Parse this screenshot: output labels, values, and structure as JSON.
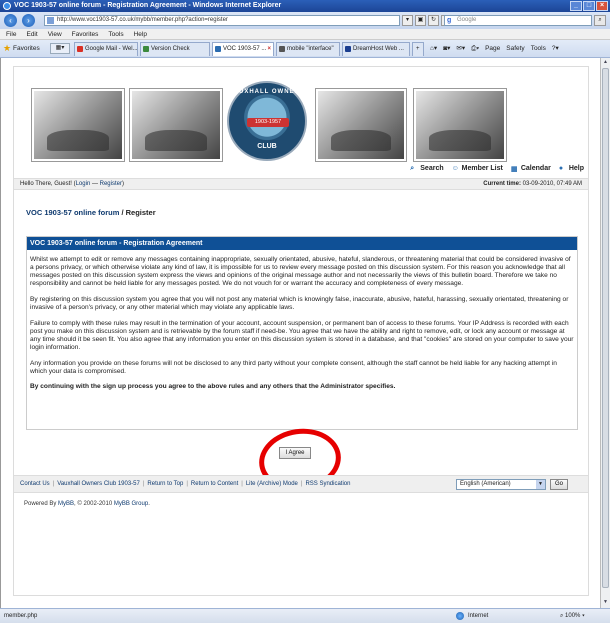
{
  "window": {
    "title": "VOC 1903-57 online forum - Registration Agreement - Windows Internet Explorer"
  },
  "address_bar": {
    "url": "http://www.voc1903-57.co.uk/mybb/member.php?action=register",
    "search_placeholder": "Google"
  },
  "menu": [
    "File",
    "Edit",
    "View",
    "Favorites",
    "Tools",
    "Help"
  ],
  "favorites_label": "Favorites",
  "tabs": [
    {
      "label": "Google Mail - Wel...",
      "color": "#d93025",
      "active": false
    },
    {
      "label": "Version Check",
      "color": "#3c8a3c",
      "active": false
    },
    {
      "label": "VOC 1903-57 ...",
      "color": "#2b6cb0",
      "active": true
    },
    {
      "label": "mobile \"interface\"",
      "color": "#555555",
      "active": false
    },
    {
      "label": "DreamHost Web ...",
      "color": "#1b3e8f",
      "active": false
    }
  ],
  "command_bar": [
    "Page",
    "Safety",
    "Tools"
  ],
  "emblem": {
    "top": "VAUXHALL OWNERS",
    "mid": "1903-1957",
    "bottom": "CLUB"
  },
  "toplinks": {
    "search": "Search",
    "member_list": "Member List",
    "calendar": "Calendar",
    "help": "Help"
  },
  "welcome": {
    "greeting": "Hello There, Guest! (",
    "login": "Login",
    "dash": " — ",
    "register": "Register",
    "close": ")",
    "time_label": "Current time:",
    "time_value": "03-09-2010, 07:49 AM"
  },
  "breadcrumb": {
    "forum": "VOC 1903-57 online forum",
    "current": " / Register"
  },
  "agreement": {
    "heading": "VOC 1903-57 online forum - Registration Agreement",
    "p1": "Whilst we attempt to edit or remove any messages containing inappropriate, sexually orientated, abusive, hateful, slanderous, or threatening material that could be considered invasive of a persons privacy, or which otherwise violate any kind of law, it is impossible for us to review every message posted on this discussion system. For this reason you acknowledge that all messages posted on this discussion system express the views and opinions of the original message author and not necessarily the views of this bulletin board. Therefore we take no responsibility and cannot be held liable for any messages posted. We do not vouch for or warrant the accuracy and completeness of every message.",
    "p2": "By registering on this discussion system you agree that you will not post any material which is knowingly false, inaccurate, abusive, hateful, harassing, sexually orientated, threatening or invasive of a person's privacy, or any other material which may violate any applicable laws.",
    "p3": "Failure to comply with these rules may result in the termination of your account, account suspension, or permanent ban of access to these forums. Your IP Address is recorded with each post you make on this discussion system and is retrievable by the forum staff if need-be. You agree that we have the ability and right to remove, edit, or lock any account or message at any time should it be seen fit. You also agree that any information you enter on this discussion system is stored in a database, and that \"cookies\" are stored on your computer to save your login information.",
    "p4": "Any information you provide on these forums will not be disclosed to any third party without your complete consent, although the staff cannot be held liable for any hacking attempt in which your data is compromised.",
    "p5": "By continuing with the sign up process you agree to the above rules and any others that the Administrator specifies."
  },
  "agree_button": "I Agree",
  "footer": {
    "links": [
      "Contact Us",
      "Vauxhall Owners Club 1903-57",
      "Return to Top",
      "Return to Content",
      "Lite (Archive) Mode",
      "RSS Syndication"
    ],
    "language": "English (American)",
    "go": "Go"
  },
  "powered": {
    "prefix": "Powered By ",
    "mybb": "MyBB",
    "suffix": ", © 2002-2010 ",
    "group": "MyBB Group",
    "end": "."
  },
  "status_bar": {
    "left": "member.php",
    "zone": "Internet",
    "zoom": "100%"
  },
  "colors": {
    "header_blue": "#0f5096",
    "link_blue": "#0f3a6f",
    "annotation_red": "#e60000"
  }
}
